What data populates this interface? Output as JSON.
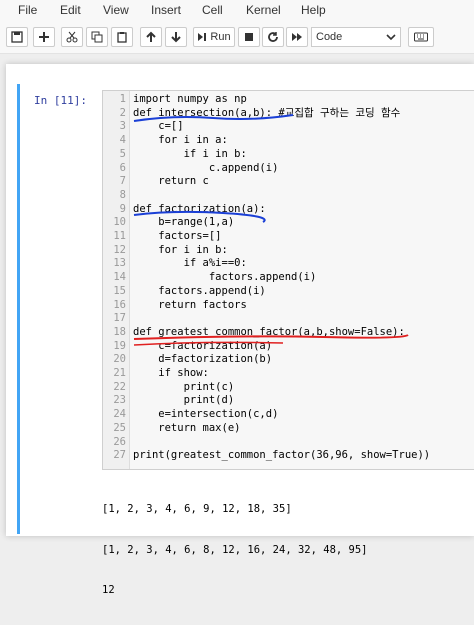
{
  "menu": [
    "File",
    "Edit",
    "View",
    "Insert",
    "Cell",
    "Kernel",
    "Help"
  ],
  "toolbar": {
    "run_label": "Run",
    "cell_type": "Code"
  },
  "cell": {
    "prompt": "In [11]:",
    "line_numbers": [
      "1",
      "2",
      "3",
      "4",
      "5",
      "6",
      "7",
      "8",
      "9",
      "10",
      "11",
      "12",
      "13",
      "14",
      "15",
      "16",
      "17",
      "18",
      "19",
      "20",
      "21",
      "22",
      "23",
      "24",
      "25",
      "26",
      "27"
    ],
    "code": [
      "import numpy as np",
      "def intersection(a,b): #교집합 구하는 코딩 함수",
      "    c=[]",
      "    for i in a:",
      "        if i in b:",
      "            c.append(i)",
      "    return c",
      "",
      "def factorization(a):",
      "    b=range(1,a)",
      "    factors=[]",
      "    for i in b:",
      "        if a%i==0:",
      "            factors.append(i)",
      "    factors.append(i)",
      "    return factors",
      "",
      "def greatest_common_factor(a,b,show=False):",
      "    c=factorization(a)",
      "    d=factorization(b)",
      "    if show:",
      "        print(c)",
      "        print(d)",
      "    e=intersection(c,d)",
      "    return max(e)",
      "",
      "print(greatest_common_factor(36,96, show=True))"
    ],
    "output": [
      "[1, 2, 3, 4, 6, 9, 12, 18, 35]",
      "[1, 2, 3, 4, 6, 8, 12, 16, 24, 32, 48, 95]",
      "12"
    ]
  }
}
